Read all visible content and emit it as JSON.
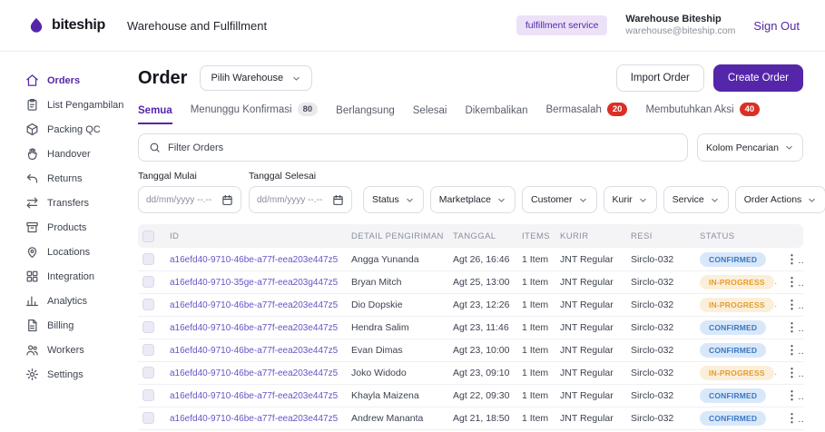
{
  "colors": {
    "brand_purple": "#5526a9",
    "brand_purple_light": "#ece2f8",
    "confirmed_bg": "#d9e8f9",
    "confirmed_text": "#3b77c2",
    "in_progress_bg": "#fcefd9",
    "in_progress_text": "#e79c2a",
    "alert_red": "#d93025",
    "neutral_badge_bg": "#e9e9ee"
  },
  "icons": {
    "logo": "biteship-droplet",
    "search": "magnifier",
    "calendar": "calendar",
    "chevron": "chevron-down",
    "kebab": "vertical-ellipsis",
    "checkbox": "checkbox-unchecked"
  },
  "header": {
    "logo_text": "biteship",
    "app_title": "Warehouse and Fulfillment",
    "service_badge": "fulfillment service",
    "account_name": "Warehouse Biteship",
    "account_email": "warehouse@biteship.com",
    "sign_out": "Sign Out"
  },
  "sidebar": {
    "items": [
      {
        "label": "Orders",
        "icon": "home",
        "active": true
      },
      {
        "label": "List Pengambilan",
        "icon": "clipboard",
        "active": false
      },
      {
        "label": "Packing QC",
        "icon": "box",
        "active": false
      },
      {
        "label": "Handover",
        "icon": "hand",
        "active": false
      },
      {
        "label": "Returns",
        "icon": "return",
        "active": false
      },
      {
        "label": "Transfers",
        "icon": "transfer",
        "active": false
      },
      {
        "label": "Products",
        "icon": "archive",
        "active": false
      },
      {
        "label": "Locations",
        "icon": "map-pin",
        "active": false
      },
      {
        "label": "Integration",
        "icon": "grid",
        "active": false
      },
      {
        "label": "Analytics",
        "icon": "chart",
        "active": false
      },
      {
        "label": "Billing",
        "icon": "document",
        "active": false
      },
      {
        "label": "Workers",
        "icon": "users",
        "active": false
      },
      {
        "label": "Settings",
        "icon": "gear",
        "active": false
      }
    ]
  },
  "toolbar": {
    "page_title": "Order",
    "warehouse_select": "Pilih Warehouse",
    "import_button": "Import Order",
    "create_button": "Create Order"
  },
  "tabs": [
    {
      "label": "Semua",
      "active": true
    },
    {
      "label": "Menunggu Konfirmasi",
      "badge": "80",
      "badge_type": "gray"
    },
    {
      "label": "Berlangsung"
    },
    {
      "label": "Selesai"
    },
    {
      "label": "Dikembalikan"
    },
    {
      "label": "Bermasalah",
      "badge": "20",
      "badge_type": "red"
    },
    {
      "label": "Membutuhkan Aksi",
      "badge": "40",
      "badge_type": "red"
    }
  ],
  "filters": {
    "search_placeholder": "Filter Orders",
    "column_select": "Kolom Pencarian",
    "date_start_label": "Tanggal Mulai",
    "date_end_label": "Tanggal Selesai",
    "date_placeholder": "dd/mm/yyyy --.--",
    "dropdowns": [
      "Status",
      "Marketplace",
      "Customer",
      "Kurir",
      "Service",
      "Order Actions"
    ]
  },
  "table": {
    "headers": [
      "ID",
      "DETAIL PENGIRIMAN",
      "TANGGAL",
      "ITEMS",
      "KURIR",
      "RESI",
      "STATUS"
    ],
    "rows": [
      {
        "id": "a16efd40-9710-46be-a77f-eea203e447z5",
        "customer": "Angga Yunanda",
        "date": "Agt 26, 16:46",
        "items": "1 Item",
        "courier": "JNT Regular",
        "resi": "Sirclo-032",
        "status": "CONFIRMED"
      },
      {
        "id": "a16efd40-9710-35ge-a77f-eea203g447z5",
        "customer": "Bryan Mitch",
        "date": "Agt 25, 13:00",
        "items": "1 Item",
        "courier": "JNT Regular",
        "resi": "Sirclo-032",
        "status": "IN-PROGRESS"
      },
      {
        "id": "a16efd40-9710-46be-a77f-eea203e447z5",
        "customer": "Dio Dopskie",
        "date": "Agt 23, 12:26",
        "items": "1 Item",
        "courier": "JNT Regular",
        "resi": "Sirclo-032",
        "status": "IN-PROGRESS"
      },
      {
        "id": "a16efd40-9710-46be-a77f-eea203e447z5",
        "customer": "Hendra Salim",
        "date": "Agt 23, 11:46",
        "items": "1 Item",
        "courier": "JNT Regular",
        "resi": "Sirclo-032",
        "status": "CONFIRMED"
      },
      {
        "id": "a16efd40-9710-46be-a77f-eea203e447z5",
        "customer": "Evan Dimas",
        "date": "Agt 23, 10:00",
        "items": "1 Item",
        "courier": "JNT Regular",
        "resi": "Sirclo-032",
        "status": "CONFIRMED"
      },
      {
        "id": "a16efd40-9710-46be-a77f-eea203e447z5",
        "customer": "Joko Widodo",
        "date": "Agt 23, 09:10",
        "items": "1 Item",
        "courier": "JNT Regular",
        "resi": "Sirclo-032",
        "status": "IN-PROGRESS"
      },
      {
        "id": "a16efd40-9710-46be-a77f-eea203e447z5",
        "customer": "Khayla Maizena",
        "date": "Agt 22, 09:30",
        "items": "1 Item",
        "courier": "JNT Regular",
        "resi": "Sirclo-032",
        "status": "CONFIRMED"
      },
      {
        "id": "a16efd40-9710-46be-a77f-eea203e447z5",
        "customer": "Andrew Mananta",
        "date": "Agt 21, 18:50",
        "items": "1 Item",
        "courier": "JNT Regular",
        "resi": "Sirclo-032",
        "status": "CONFIRMED"
      }
    ]
  }
}
